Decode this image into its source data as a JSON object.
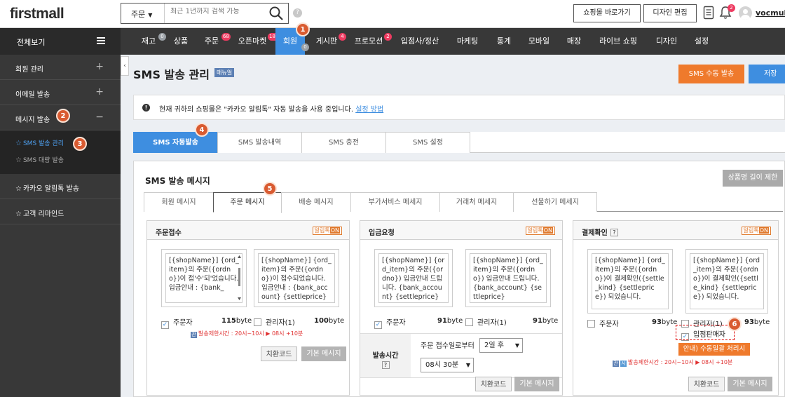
{
  "header": {
    "logo": "firstmall",
    "search_type": "주문",
    "search_placeholder": "최근 1년까지 검색 가능",
    "help": "?",
    "shop_link": "쇼핑몰 바로가기",
    "design_edit": "디자인 편집",
    "notif_count": "2",
    "username": "vocmulti"
  },
  "nav": {
    "all": "전체보기",
    "items": [
      {
        "label": "재고",
        "count": "0"
      },
      {
        "label": "상품",
        "count": ""
      },
      {
        "label": "주문",
        "count": "68"
      },
      {
        "label": "오픈마켓",
        "count": "1852"
      },
      {
        "label": "회원",
        "count": "0"
      },
      {
        "label": "게시판",
        "count": "4"
      },
      {
        "label": "프로모션",
        "count": "2"
      },
      {
        "label": "입점사/정산",
        "count": ""
      },
      {
        "label": "마케팅",
        "count": ""
      },
      {
        "label": "통계",
        "count": ""
      },
      {
        "label": "모바일",
        "count": ""
      },
      {
        "label": "매장",
        "count": ""
      },
      {
        "label": "라이브 쇼핑",
        "count": ""
      },
      {
        "label": "디자인",
        "count": ""
      },
      {
        "label": "설정",
        "count": ""
      }
    ]
  },
  "sidebar": {
    "member": "회원 관리",
    "email": "이메일 발송",
    "message": "메시지 발송",
    "sub": [
      "SMS 발송 관리",
      "SMS 대량 발송"
    ],
    "kakao": "카카오 알림톡 발송",
    "remind": "고객 리마인드"
  },
  "page": {
    "title": "SMS 발송 관리",
    "manual": "매뉴얼",
    "manual_send": "SMS 수동 발송",
    "save": "저장",
    "notice": "현재 귀하의 쇼핑몰은 \"카카오 알림톡\" 자동 발송을 사용 중입니다.",
    "notice_link": "설정 방법"
  },
  "tabs": [
    "SMS 자동발송",
    "SMS 발송내역",
    "SMS 충전",
    "SMS 설정"
  ],
  "panel": {
    "title": "SMS 발송 메시지",
    "limit_btn": "상품명 길이 제한",
    "subtabs": [
      "회원 메시지",
      "주문 메시지",
      "배송 메시지",
      "부가서비스 메세지",
      "거래처 메세지",
      "선물하기 메세지"
    ]
  },
  "alim_label": "알림톡",
  "alim_on": "ON",
  "cards": {
    "c1": {
      "title": "주문접수",
      "msg1": "[{shopName}] {ord_item}의 주문({ordno})이 접'수'되'었습니다. 입금안내 : {bank_",
      "msg2": "[{shopName}] {ord_item}의 주문({ordno})이 접수되었습니다. 입금안내 : {bank_account} {settleprice}",
      "chk1": "주문자",
      "byte1": "115",
      "chk2": "관리자(1)",
      "byte2": "100",
      "restrict": "발송제한시간 : 20시~10시 ▶ 08시 +10분",
      "convert": "치환코드",
      "default": "기본 메시지"
    },
    "c2": {
      "title": "입금요청",
      "msg1": "[{shopName}] {ord_item}의 주문({ordno}) 입금안내 드립니다. {bank_account} {settleprice}",
      "msg2": "[{shopName}] {ord_item}의 주문({ordno}) 입금안내 드립니다. {bank_account} {settleprice}",
      "chk1": "주문자",
      "byte1": "91",
      "chk2": "관리자(1)",
      "byte2": "91",
      "time_label": "발송시간",
      "time_text": "주문 접수일로부터",
      "days": "2일 후",
      "hour": "08시 30분",
      "convert": "치환코드",
      "default": "기본 메시지"
    },
    "c3": {
      "title": "결제확인",
      "msg1": "[{shopName}] {ord_item}의 주문({ordno})이 결제확인({settle_kind} {settleprice}) 되었습니다.",
      "msg2": "[{shopName}] {ord_item}의 주문({ordno})이 결제확인({settle_kind} {settleprice}) 되었습니다.",
      "chk1": "주문자",
      "byte1": "93",
      "chk2": "관리자(1)",
      "byte2": "93",
      "chk3": "입점판매자",
      "guide": "안내) 수동일괄 처리시",
      "restrict": "발송제한시간 : 20시~10시 ▶ 08시 +10분",
      "convert": "치환코드",
      "default": "기본 메시지"
    }
  },
  "byte_unit": "byte",
  "restrict_icons": [
    "관",
    "시"
  ],
  "markers": [
    "1",
    "2",
    "3",
    "4",
    "5",
    "6"
  ],
  "colors": {
    "accent": "#3e8ee0",
    "orange": "#ef7a2c",
    "nav_bg": "#383838",
    "badge": "#ee3b61",
    "marker": "#d95b31"
  }
}
